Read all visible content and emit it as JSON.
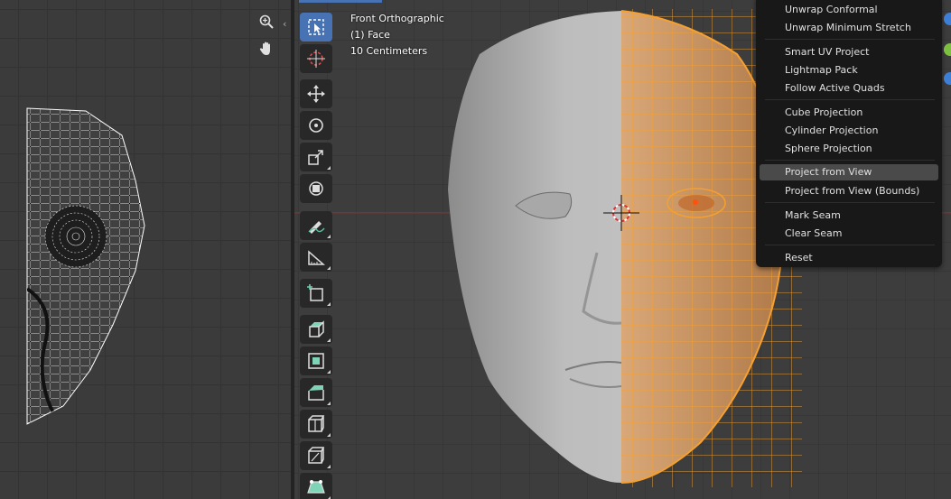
{
  "viewport": {
    "overlay": {
      "view_name": "Front Orthographic",
      "object_name": "(1) Face",
      "scale": "10 Centimeters"
    }
  },
  "uv_editor": {
    "nav": [
      {
        "name": "zoom-icon"
      },
      {
        "name": "hand-icon"
      }
    ]
  },
  "toolbar": {
    "tools": [
      "select-box-icon",
      "cursor-icon",
      "move-icon",
      "rotate-icon",
      "scale-icon",
      "transform-icon",
      "annotate-icon",
      "measure-icon",
      "add-cube-icon",
      "extrude-icon",
      "inset-icon",
      "bevel-icon",
      "loop-cut-icon",
      "knife-icon",
      "poly-build-icon"
    ]
  },
  "uv_menu": {
    "items": [
      {
        "label": "Unwrap Conformal"
      },
      {
        "label": "Unwrap Minimum Stretch"
      },
      {
        "label": "Smart UV Project"
      },
      {
        "label": "Lightmap Pack"
      },
      {
        "label": "Follow Active Quads"
      },
      {
        "label": "Cube Projection"
      },
      {
        "label": "Cylinder Projection"
      },
      {
        "label": "Sphere Projection"
      },
      {
        "label": "Project from View"
      },
      {
        "label": "Project from View (Bounds)"
      },
      {
        "label": "Mark Seam"
      },
      {
        "label": "Clear Seam"
      },
      {
        "label": "Reset"
      }
    ],
    "highlighted": "Project from View"
  },
  "colors": {
    "accent": "#4772b3",
    "selection_orange": "#f5a030",
    "menu_bg": "#181818"
  }
}
